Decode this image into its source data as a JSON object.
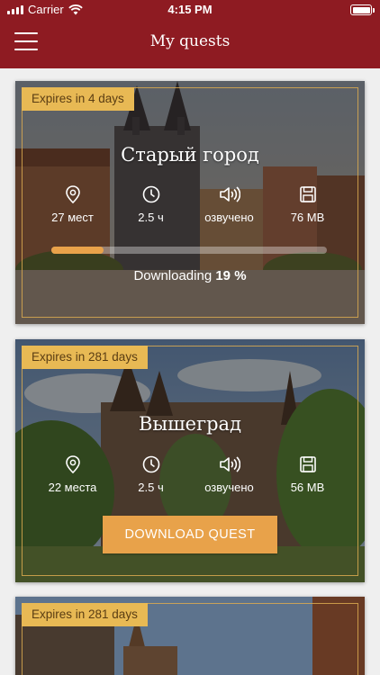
{
  "status_bar": {
    "carrier": "Carrier",
    "time": "4:15 PM"
  },
  "nav": {
    "title": "My quests"
  },
  "quests": [
    {
      "expires": "Expires in 4 days",
      "title": "Старый город",
      "places": "27 мест",
      "duration": "2.5 ч",
      "audio": "озвучено",
      "size": "76 MB",
      "download_label": "Downloading",
      "download_percent": "19 %",
      "progress": 0.19
    },
    {
      "expires": "Expires in 281 days",
      "title": "Вышеград",
      "places": "22 места",
      "duration": "2.5 ч",
      "audio": "озвучено",
      "size": "56 MB",
      "button_label": "DOWNLOAD QUEST"
    },
    {
      "expires": "Expires in 281 days"
    }
  ],
  "colors": {
    "nav_bg": "#8e1b22",
    "accent": "#e8a24a",
    "badge": "#e8b954"
  }
}
